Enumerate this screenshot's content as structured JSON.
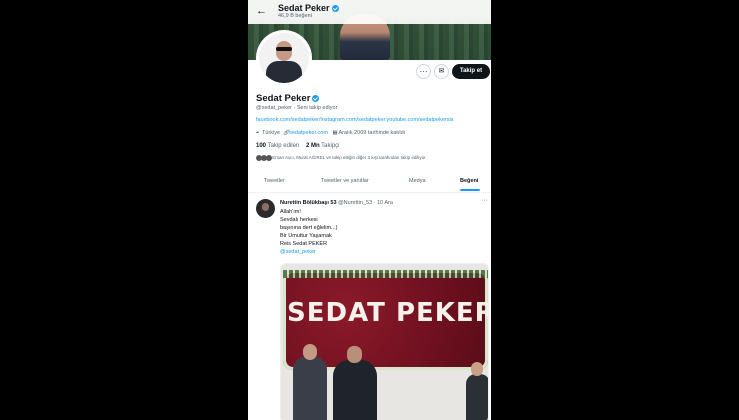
{
  "header": {
    "back_icon": "arrow-left-icon",
    "name": "Sedat Peker",
    "subtitle": "46,9 B beğeni"
  },
  "profile": {
    "name": "Sedat Peker",
    "handle": "@sedat_peker · Seni takip ediyor",
    "links_line": "facebook.com/sedatpeker/instagram.com/sedatpeker.youtube.com/sedatpekersis",
    "location": "Türkiye",
    "website": "sedatpeker.com",
    "joined": "Aralık 2009 tarihinde katıldı",
    "following_count": "100",
    "following_label": "Takip edilen",
    "followers_count": "2 Mn",
    "followers_label": "Takipçi",
    "followed_by": "Ersan Avcı, Murat AĞIREL ve takip ettiğin diğer 3 kişi tarafından takip ediliyor"
  },
  "actions": {
    "more_label": "···",
    "message_label": "✉",
    "follow_label": "Takip et"
  },
  "tabs": [
    {
      "label": "Tweetler"
    },
    {
      "label": "Tweetler ve yanıtlar"
    },
    {
      "label": "Medya"
    },
    {
      "label": "Beğeni"
    }
  ],
  "tweet": {
    "author": "Nurettin Bölükbaşı 53",
    "meta": "@Nurettin_53 · 10 Ara",
    "more": "···",
    "lines": [
      "Allah'ım!",
      "Sevdalı herkesi",
      "başınına dert eğlelim...)",
      "Bir Umuttur Yaşamak",
      "Reis Sedat PEKER"
    ],
    "mention": "@sedat_peker",
    "image_text": "SEDAT PEKER"
  },
  "colors": {
    "accent": "#1d9bf0",
    "text": "#0f1419",
    "muted": "#536471"
  }
}
